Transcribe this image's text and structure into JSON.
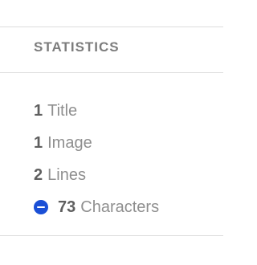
{
  "statistics": {
    "header": "STATISTICS",
    "items": [
      {
        "count": "1",
        "label": "Title"
      },
      {
        "count": "1",
        "label": "Image"
      },
      {
        "count": "2",
        "label": "Lines"
      },
      {
        "count": "73",
        "label": "Characters",
        "icon": "minus-circle-icon",
        "icon_color": "#1a4fd6"
      }
    ]
  }
}
